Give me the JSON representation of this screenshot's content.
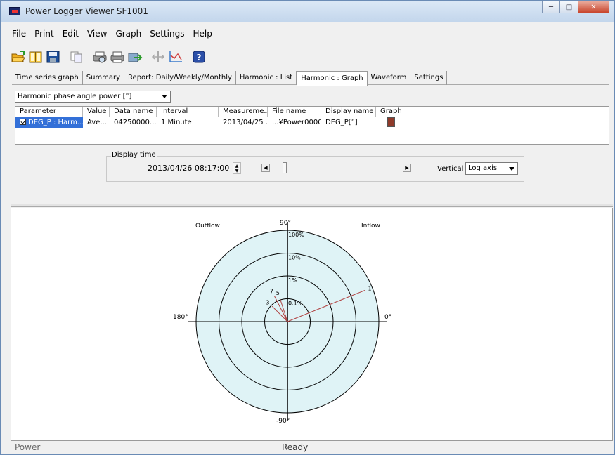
{
  "window": {
    "title": "Power Logger Viewer SF1001"
  },
  "menu": [
    {
      "label": "File",
      "key": "F"
    },
    {
      "label": "Print",
      "key": "P"
    },
    {
      "label": "Edit",
      "key": "E"
    },
    {
      "label": "View",
      "key": "V"
    },
    {
      "label": "Graph",
      "key": "G"
    },
    {
      "label": "Settings",
      "key": "S"
    },
    {
      "label": "Help",
      "key": "H"
    }
  ],
  "toolbar": {
    "icons": [
      "open-folder-icon",
      "book-icon",
      "save-icon",
      "copy-icon",
      "print-preview-icon",
      "print-icon",
      "export-icon",
      "cursor-icon",
      "graph-settings-icon",
      "help-icon"
    ]
  },
  "tabs": [
    {
      "label": "Time series graph"
    },
    {
      "label": "Summary"
    },
    {
      "label": "Report: Daily/Weekly/Monthly"
    },
    {
      "label": "Harmonic : List"
    },
    {
      "label": "Harmonic : Graph",
      "active": true
    },
    {
      "label": "Waveform"
    },
    {
      "label": "Settings"
    }
  ],
  "selector": {
    "value": "Harmonic phase angle power [°]"
  },
  "table": {
    "columns": [
      "Parameter",
      "Value",
      "Data name",
      "Interval",
      "Measureme...",
      "File name",
      "Display name",
      "Graph"
    ],
    "rows": [
      {
        "parameter": "DEG_P : Harm...",
        "value": "Ave...",
        "data_name": "04250000...",
        "interval": "1 Minute",
        "measurement": "2013/04/25 ...",
        "file_name": "...¥Power0000",
        "display_name": "DEG_P[°]",
        "graph_color": "#8f3a2a"
      }
    ]
  },
  "display_time": {
    "legend": "Display time",
    "value": "2013/04/26  08:17:00",
    "vertical_label": "Vertical",
    "vertical_value": "Log axis"
  },
  "polar": {
    "labels": {
      "outflow": "Outflow",
      "inflow": "Inflow",
      "deg90": "90°",
      "deg180": "180°",
      "deg0": "0°",
      "degm90": "-90°"
    },
    "ring_labels": [
      "100%",
      "10%",
      "1%",
      "0.1%"
    ],
    "fill_color": "#dff3f6",
    "vector_color": "#b04040",
    "vectors": [
      {
        "order": "1",
        "angle_deg": 22,
        "magnitude_pct": 45
      },
      {
        "order": "3",
        "angle_deg": 135,
        "magnitude_pct": 0.09
      },
      {
        "order": "5",
        "angle_deg": 108,
        "magnitude_pct": 0.12
      },
      {
        "order": "7",
        "angle_deg": 117,
        "magnitude_pct": 0.18
      }
    ]
  },
  "status": {
    "left": "Power",
    "center": "Ready"
  }
}
